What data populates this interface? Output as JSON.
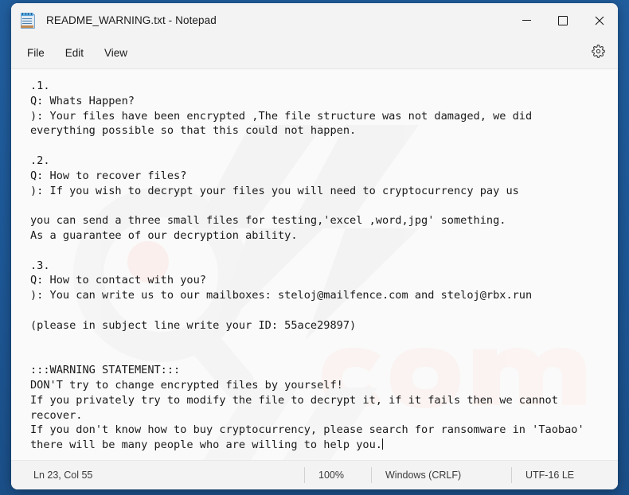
{
  "window": {
    "title": "README_WARNING.txt - Notepad",
    "app_icon": "notepad-icon",
    "controls": {
      "minimize": "minimize-icon",
      "maximize": "maximize-icon",
      "close": "close-icon"
    }
  },
  "menubar": {
    "items": [
      {
        "label": "File"
      },
      {
        "label": "Edit"
      },
      {
        "label": "View"
      }
    ],
    "settings_icon": "gear-icon"
  },
  "document": {
    "content": ".1.\nQ: Whats Happen?\n): Your files have been encrypted ,The file structure was not damaged, we did\neverything possible so that this could not happen.\n\n.2.\nQ: How to recover files?\n): If you wish to decrypt your files you will need to cryptocurrency pay us\n\nyou can send a three small files for testing,'excel ,word,jpg' something.\nAs a guarantee of our decryption ability.\n\n.3.\nQ: How to contact with you?\n): You can write us to our mailboxes: steloj@mailfence.com and steloj@rbx.run\n\n(please in subject line write your ID: 55ace29897)\n\n\n:::WARNING STATEMENT:::\nDON'T try to change encrypted files by yourself!\nIf you privately try to modify the file to decrypt it, if it fails then we cannot\nrecover.\nIf you don't know how to buy cryptocurrency, please search for ransomware in 'Taobao'\nthere will be many people who are willing to help you.",
    "contact_emails": [
      "steloj@mailfence.com",
      "steloj@rbx.run"
    ],
    "victim_id": "55ace29897"
  },
  "statusbar": {
    "position": "Ln 23, Col 55",
    "zoom": "100%",
    "line_ending": "Windows (CRLF)",
    "encoding": "UTF-16 LE"
  },
  "colors": {
    "desktop": "#1d5795",
    "window_chrome": "#f3f3f3",
    "text_area": "#fafafa",
    "text": "#1a1a1a",
    "accent_close_hover": "#c42b1c"
  }
}
